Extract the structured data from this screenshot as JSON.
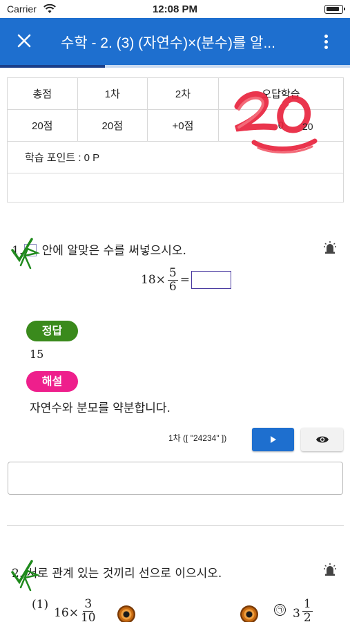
{
  "status_bar": {
    "carrier": "Carrier",
    "time": "12:08 PM"
  },
  "app_bar": {
    "title": "수학 - 2. (3) (자연수)×(분수)를 알..."
  },
  "progress": {
    "fraction": 0.3
  },
  "score_table": {
    "headers": [
      "총점",
      "1차",
      "2차",
      "오답학습"
    ],
    "values": [
      "20점",
      "20점",
      "+0점",
      "0"
    ],
    "points_label": "학습 포인트 : 0 P",
    "stamp": "20"
  },
  "question1": {
    "number": "1.",
    "text": "안에 알맞은 수를 써넣으시오.",
    "formula": {
      "whole": "18",
      "times": "×",
      "numerator": "5",
      "denominator": "6",
      "equals": "="
    },
    "answer_badge": "정답",
    "answer": "15",
    "explain_badge": "해설",
    "explanation": "자연수와 분모를 약분합니다.",
    "attempt_label": "1차 ([ \"24234\" ])",
    "input_value": ""
  },
  "question2": {
    "number": "2.",
    "text": "서로 관계 있는 것끼리 선으로 이으시오.",
    "left_item": {
      "label": "(1)",
      "whole": "16",
      "times": "×",
      "numerator": "3",
      "denominator": "10"
    },
    "right_item": {
      "label": "㉠",
      "whole": "3",
      "numerator": "1",
      "denominator": "2"
    }
  },
  "colors": {
    "app_bar": "#1e6fcf",
    "answer_badge": "#3a8a1c",
    "explain_badge": "#ee1f8c",
    "stamp": "#e8203a"
  },
  "icons": [
    "close-icon",
    "more-vert-icon",
    "alarm-icon",
    "play-icon",
    "eye-icon",
    "check-icon"
  ]
}
